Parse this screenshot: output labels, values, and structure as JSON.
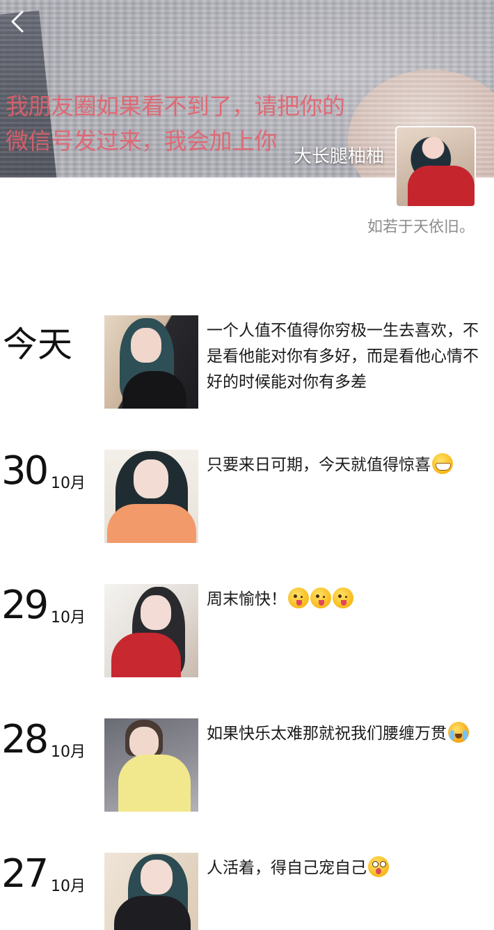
{
  "header": {
    "back_icon": "chevron-left-icon",
    "cover_text_line1": "我朋友圈如果看不到了，请把你的",
    "cover_text_line2": "微信号发过来，我会加上你",
    "nickname": "大长腿柚柚",
    "signature": "如若于天依旧。"
  },
  "posts": [
    {
      "date_label": "今天",
      "text": "一个人值不值得你穷极一生去喜欢，不是看他能对你有多好，而是看他心情不好的时候能对你有多差",
      "emoji": []
    },
    {
      "day": "30",
      "month": "10月",
      "text": "只要来日可期，今天就值得惊喜",
      "emoji": [
        "grin-icon"
      ]
    },
    {
      "day": "29",
      "month": "10月",
      "text": "周末愉快！",
      "emoji": [
        "wink-tongue-icon",
        "wink-tongue-icon",
        "wink-tongue-icon"
      ]
    },
    {
      "day": "28",
      "month": "10月",
      "text": "如果快乐太难那就祝我们腰缠万贯",
      "emoji": [
        "crying-laughing-icon"
      ]
    },
    {
      "day": "27",
      "month": "10月",
      "text": "人活着，得自己宠自己",
      "emoji": [
        "surprised-tongue-icon"
      ]
    }
  ]
}
